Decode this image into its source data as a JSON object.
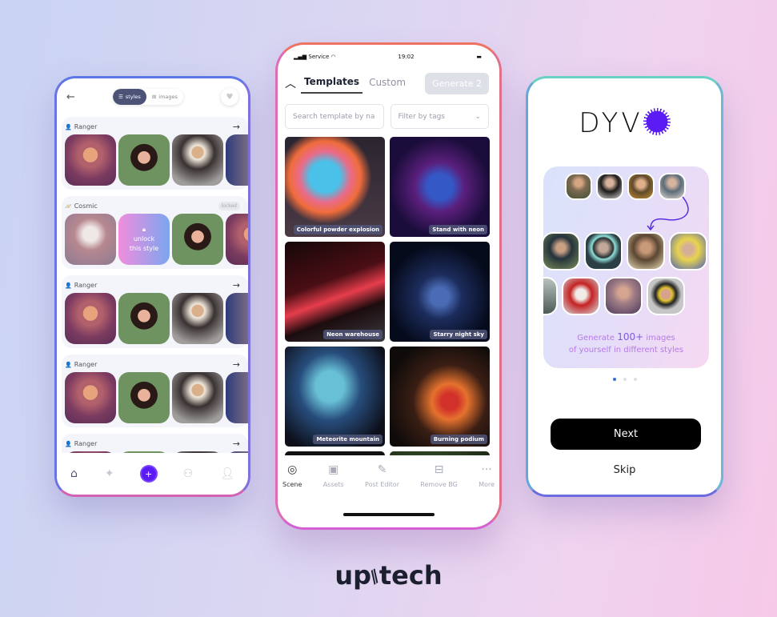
{
  "left_phone": {
    "back_icon": "back-arrow-icon",
    "segmented": {
      "styles_label": "styles",
      "images_label": "images"
    },
    "favorite_icon": "heart-icon",
    "styles": [
      {
        "name": "Ranger",
        "badge": "",
        "action": "arrow-right-icon",
        "locked": false
      },
      {
        "name": "Cosmic",
        "badge": "locked",
        "action": "",
        "locked": true,
        "unlock_text_line1": "unlock",
        "unlock_text_line2": "this style"
      },
      {
        "name": "Ranger",
        "badge": "",
        "action": "arrow-right-icon",
        "locked": false
      },
      {
        "name": "Ranger",
        "badge": "",
        "action": "arrow-right-icon",
        "locked": false
      },
      {
        "name": "Ranger",
        "badge": "",
        "action": "arrow-right-icon",
        "locked": false
      }
    ],
    "bottom_nav": [
      "home-icon",
      "sparkle-icon",
      "create-icon",
      "binoculars-icon",
      "profile-icon"
    ]
  },
  "center_phone": {
    "status": {
      "carrier": "Service",
      "time": "19:02"
    },
    "tabs": [
      {
        "label": "Templates",
        "active": true
      },
      {
        "label": "Custom",
        "active": false
      }
    ],
    "generate_button": "Generate 2",
    "search_placeholder": "Search template by na",
    "filter_label": "Filter by tags",
    "templates": [
      {
        "label": "Colorful powder explosion"
      },
      {
        "label": "Stand with neon"
      },
      {
        "label": "Neon warehouse"
      },
      {
        "label": "Starry night sky"
      },
      {
        "label": "Meteorite mountain"
      },
      {
        "label": "Burning podium"
      },
      {
        "label": ""
      },
      {
        "label": ""
      }
    ],
    "bottom_nav": [
      {
        "label": "Scene",
        "icon": "camera-icon",
        "active": true
      },
      {
        "label": "Assets",
        "icon": "image-icon",
        "active": false
      },
      {
        "label": "Post Editor",
        "icon": "pencil-icon",
        "active": false
      },
      {
        "label": "Remove BG",
        "icon": "scan-icon",
        "active": false
      },
      {
        "label": "More",
        "icon": "more-icon",
        "active": false
      }
    ]
  },
  "right_phone": {
    "logo_text": "DYV",
    "promo_line1_prefix": "Generate ",
    "promo_highlight": "100+",
    "promo_line1_suffix": " images",
    "promo_line2": "of yourself in different styles",
    "pagination": {
      "current": 1,
      "total": 3
    },
    "next_button": "Next",
    "skip_link": "Skip"
  },
  "brand": {
    "left": "up",
    "right": "tech"
  },
  "colors": {
    "accent_purple": "#5b1cf3",
    "nav_active": "#4b5477",
    "next_button": "#000000"
  }
}
